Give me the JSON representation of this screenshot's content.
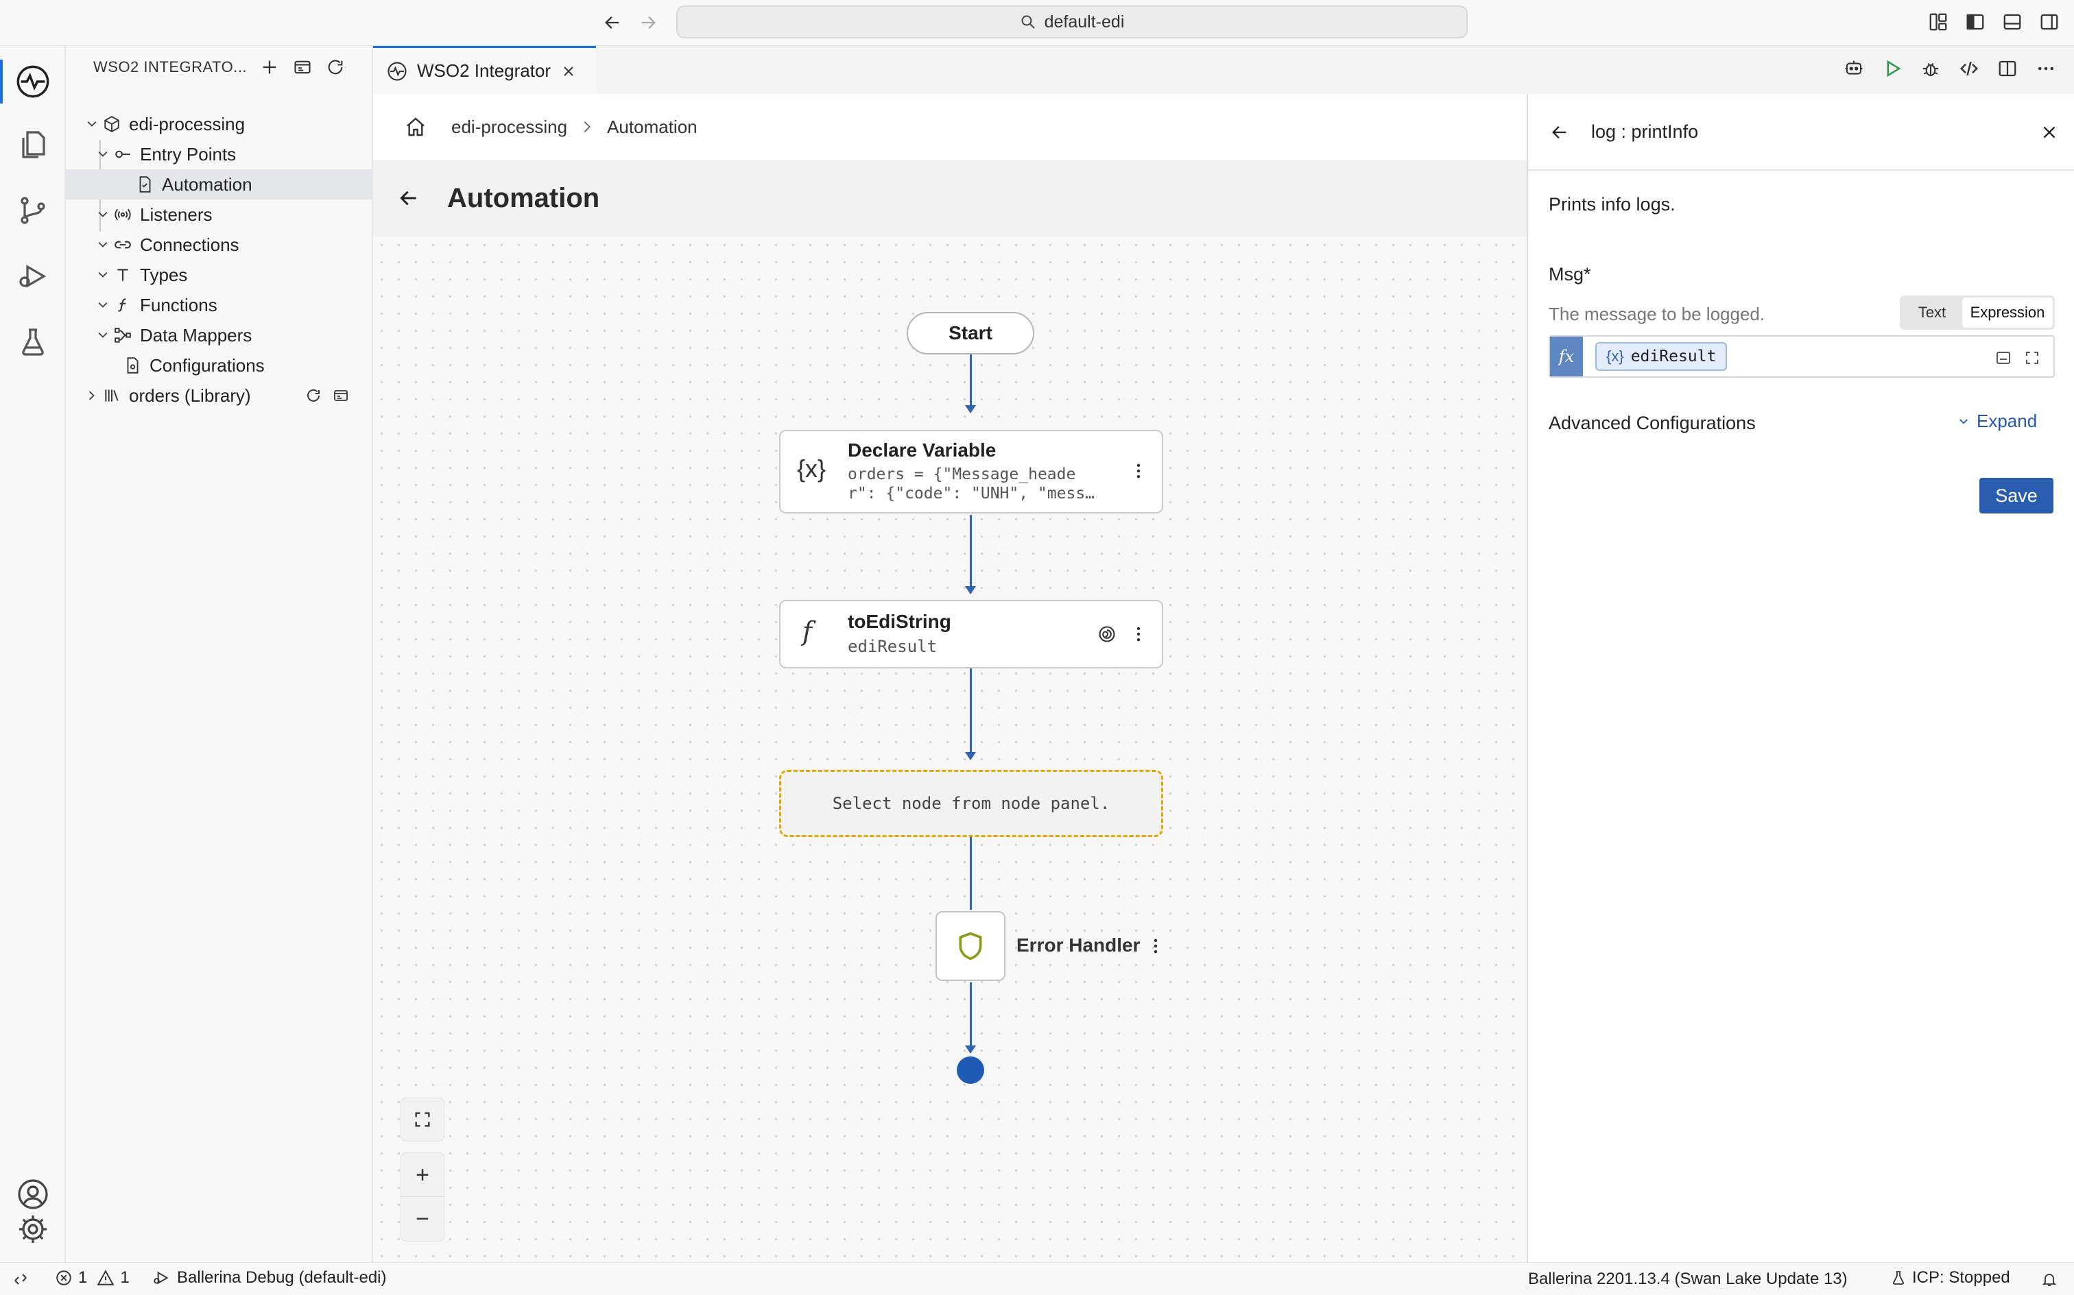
{
  "titlebar": {
    "search_text": "default-edi"
  },
  "sidebar": {
    "header": "WSO2 INTEGRATO...",
    "tree": {
      "project": "edi-processing",
      "entry_points": "Entry Points",
      "automation": "Automation",
      "listeners": "Listeners",
      "connections": "Connections",
      "types": "Types",
      "functions": "Functions",
      "data_mappers": "Data Mappers",
      "configurations": "Configurations",
      "library": "orders (Library)"
    }
  },
  "tab": {
    "label": "WSO2 Integrator"
  },
  "breadcrumb": {
    "root": "edi-processing",
    "current": "Automation"
  },
  "page": {
    "title": "Automation"
  },
  "flow": {
    "start_label": "Start",
    "declare": {
      "title": "Declare Variable",
      "line1": "orders = {\"Message_heade",
      "line2": "r\": {\"code\": \"UNH\", \"mess…",
      "icon_text": "{x}"
    },
    "func": {
      "title": "toEdiString",
      "subtitle": "ediResult",
      "icon_text": "f"
    },
    "placeholder": "Select node from node panel.",
    "error_handler": "Error Handler"
  },
  "zoom": {
    "fit": "⛶",
    "plus": "+",
    "minus": "−"
  },
  "panel": {
    "title": "log : printInfo",
    "description": "Prints info logs.",
    "field_label": "Msg*",
    "field_hint": "The message to be logged.",
    "mode_text": "Text",
    "mode_expression": "Expression",
    "fx_label": "fx",
    "chip_prefix": "{x}",
    "chip_value": "ediResult",
    "advanced": "Advanced Configurations",
    "expand": "Expand",
    "save": "Save"
  },
  "status": {
    "errors": "1",
    "warnings": "1",
    "debug": "Ballerina Debug (default-edi)",
    "version": "Ballerina 2201.13.4 (Swan Lake Update 13)",
    "icp": "ICP: Stopped"
  },
  "colors": {
    "accent": "#1e6fd9",
    "edge": "#2f64b3",
    "placeholder_border": "#e0a800",
    "save_bg": "#2a5db0"
  }
}
